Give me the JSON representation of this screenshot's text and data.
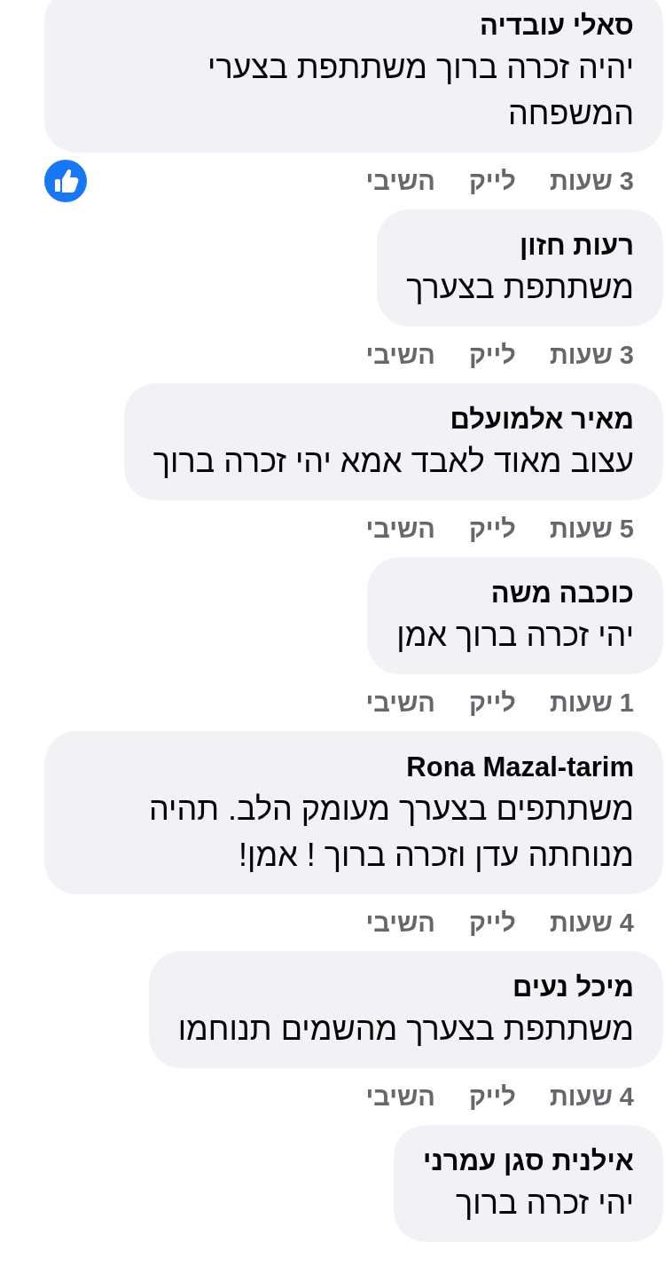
{
  "comments": [
    {
      "author": "סאלי עובדיה",
      "text": "יהיה זכרה ברוך משתתפת בצערי המשפחה",
      "time": "3 שעות",
      "like": "לייק",
      "reply": "השיבי",
      "has_like_reaction": true
    },
    {
      "author": "רעות חזון",
      "text": "משתתפת בצערך",
      "time": "3 שעות",
      "like": "לייק",
      "reply": "השיבי",
      "has_like_reaction": false
    },
    {
      "author": "מאיר אלמועלם",
      "text": "עצוב מאוד לאבד אמא יהי זכרה ברוך",
      "time": "5 שעות",
      "like": "לייק",
      "reply": "השיבי",
      "has_like_reaction": false
    },
    {
      "author": "כוכבה משה",
      "text": "יהי זכרה ברוך אמן",
      "time": "1 שעות",
      "like": "לייק",
      "reply": "השיבי",
      "has_like_reaction": false
    },
    {
      "author": "Rona Mazal-tarim",
      "text": "משתתפים בצערך מעומק הלב. תהיה מנוחתה עדן וזכרה ברוך ! אמן!",
      "time": "4 שעות",
      "like": "לייק",
      "reply": "השיבי",
      "has_like_reaction": false
    },
    {
      "author": "מיכל נעים",
      "text": "משתתפת בצערך מהשמים תנוחמו",
      "time": "4 שעות",
      "like": "לייק",
      "reply": "השיבי",
      "has_like_reaction": false
    },
    {
      "author": "אילנית סגן עמרני",
      "text": "יהי זכרה ברוך"
    }
  ]
}
